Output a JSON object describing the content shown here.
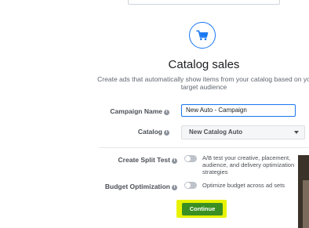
{
  "header": {
    "title": "Catalog sales",
    "subtitle_line1": "Create ads that automatically show items from your catalog based on yo",
    "subtitle_line2": "target audience"
  },
  "form": {
    "campaign_name_label": "Campaign Name",
    "campaign_name_value": "New Auto - Campaign",
    "catalog_label": "Catalog",
    "catalog_selected": "New Catalog Auto",
    "split_test_label": "Create Split Test",
    "split_test_text": [
      "A/B test your creative, placement,",
      "audience, and delivery optimization",
      "strategies"
    ],
    "budget_label": "Budget Optimization",
    "budget_text": "Optimize budget across ad sets",
    "info_glyph": "i"
  },
  "actions": {
    "continue_label": "Continue"
  },
  "colors": {
    "accent": "#1877f2",
    "continue_button": "#3a8f22",
    "highlight": "#e8f200"
  },
  "icons": {
    "header_icon": "shopping-cart-icon",
    "field_info": "info-icon",
    "select_chevron": "chevron-down-icon"
  }
}
